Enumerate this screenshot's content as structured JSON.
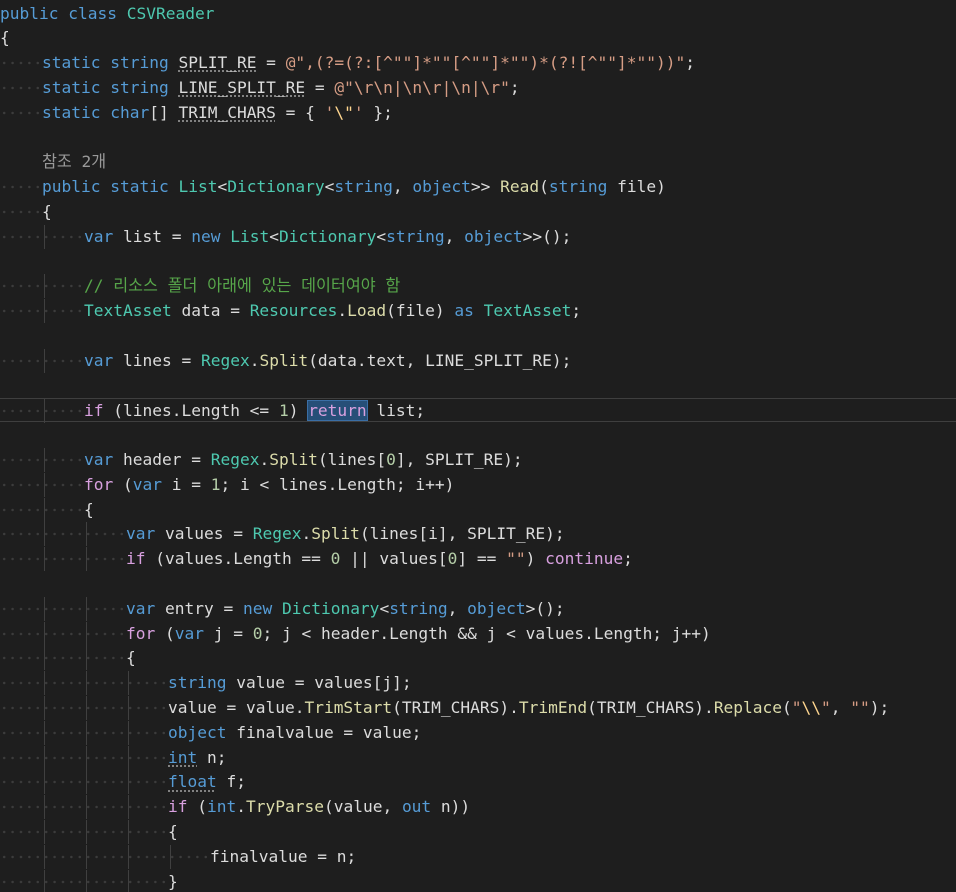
{
  "editor": {
    "language": "csharp",
    "theme": "dark",
    "lines": [
      {
        "indent": 0,
        "tokens": [
          {
            "c": "k",
            "v": "public"
          },
          {
            "c": "u",
            "v": " "
          },
          {
            "c": "k",
            "v": "class"
          },
          {
            "c": "u",
            "v": " "
          },
          {
            "c": "t",
            "v": "CSVReader"
          }
        ]
      },
      {
        "indent": 0,
        "tokens": [
          {
            "c": "u",
            "v": "{"
          }
        ]
      },
      {
        "indent": 1,
        "tokens": [
          {
            "c": "k",
            "v": "static"
          },
          {
            "c": "u",
            "v": " "
          },
          {
            "c": "k",
            "v": "string"
          },
          {
            "c": "u",
            "v": " "
          },
          {
            "c": "u sq",
            "v": "SPLIT_RE"
          },
          {
            "c": "u",
            "v": " = "
          },
          {
            "c": "s",
            "v": "@\",(?=(?:[^\"\"]*\"\"[^\"\"]*\"\")*(?![^\"\"]*\"\"))\""
          },
          {
            "c": "u",
            "v": ";"
          }
        ]
      },
      {
        "indent": 1,
        "tokens": [
          {
            "c": "k",
            "v": "static"
          },
          {
            "c": "u",
            "v": " "
          },
          {
            "c": "k",
            "v": "string"
          },
          {
            "c": "u",
            "v": " "
          },
          {
            "c": "u sq",
            "v": "LINE_SPLIT_RE"
          },
          {
            "c": "u",
            "v": " = "
          },
          {
            "c": "s",
            "v": "@\"\\r\\n|\\n\\r|\\n|\\r\""
          },
          {
            "c": "u",
            "v": ";"
          }
        ]
      },
      {
        "indent": 1,
        "tokens": [
          {
            "c": "k",
            "v": "static"
          },
          {
            "c": "u",
            "v": " "
          },
          {
            "c": "k",
            "v": "char"
          },
          {
            "c": "u",
            "v": "[] "
          },
          {
            "c": "u sq",
            "v": "TRIM_CHARS"
          },
          {
            "c": "u",
            "v": " = { "
          },
          {
            "c": "s",
            "v": "'"
          },
          {
            "c": "se",
            "v": "\\\""
          },
          {
            "c": "s",
            "v": "'"
          },
          {
            "c": "u",
            "v": " };"
          }
        ]
      },
      {
        "indent": 0,
        "blank": true,
        "tokens": []
      },
      {
        "indent": 1,
        "noguide": true,
        "tokens": [
          {
            "c": "ref",
            "v": "참조 2개"
          }
        ]
      },
      {
        "indent": 1,
        "tokens": [
          {
            "c": "k",
            "v": "public"
          },
          {
            "c": "u",
            "v": " "
          },
          {
            "c": "k",
            "v": "static"
          },
          {
            "c": "u",
            "v": " "
          },
          {
            "c": "t",
            "v": "List"
          },
          {
            "c": "u",
            "v": "<"
          },
          {
            "c": "t",
            "v": "Dictionary"
          },
          {
            "c": "u",
            "v": "<"
          },
          {
            "c": "k",
            "v": "string"
          },
          {
            "c": "u",
            "v": ", "
          },
          {
            "c": "k",
            "v": "object"
          },
          {
            "c": "u",
            "v": ">> "
          },
          {
            "c": "m",
            "v": "Read"
          },
          {
            "c": "u",
            "v": "("
          },
          {
            "c": "k",
            "v": "string"
          },
          {
            "c": "u",
            "v": " "
          },
          {
            "c": "u",
            "v": "file"
          },
          {
            "c": "u",
            "v": ")"
          }
        ]
      },
      {
        "indent": 1,
        "tokens": [
          {
            "c": "u",
            "v": "{"
          }
        ]
      },
      {
        "indent": 2,
        "tokens": [
          {
            "c": "k",
            "v": "var"
          },
          {
            "c": "u",
            "v": " list = "
          },
          {
            "c": "k",
            "v": "new"
          },
          {
            "c": "u",
            "v": " "
          },
          {
            "c": "t",
            "v": "List"
          },
          {
            "c": "u",
            "v": "<"
          },
          {
            "c": "t",
            "v": "Dictionary"
          },
          {
            "c": "u",
            "v": "<"
          },
          {
            "c": "k",
            "v": "string"
          },
          {
            "c": "u",
            "v": ", "
          },
          {
            "c": "k",
            "v": "object"
          },
          {
            "c": "u",
            "v": ">>();"
          }
        ]
      },
      {
        "indent": 0,
        "blank": true,
        "tokens": []
      },
      {
        "indent": 2,
        "tokens": [
          {
            "c": "c",
            "v": "// 리소스 폴더 아래에 있는 데이터여야 함"
          }
        ]
      },
      {
        "indent": 2,
        "tokens": [
          {
            "c": "t",
            "v": "TextAsset"
          },
          {
            "c": "u",
            "v": " data = "
          },
          {
            "c": "t",
            "v": "Resources"
          },
          {
            "c": "u",
            "v": "."
          },
          {
            "c": "m",
            "v": "Load"
          },
          {
            "c": "u",
            "v": "(file) "
          },
          {
            "c": "k",
            "v": "as"
          },
          {
            "c": "u",
            "v": " "
          },
          {
            "c": "t",
            "v": "TextAsset"
          },
          {
            "c": "u",
            "v": ";"
          }
        ]
      },
      {
        "indent": 0,
        "blank": true,
        "tokens": []
      },
      {
        "indent": 2,
        "tokens": [
          {
            "c": "k",
            "v": "var"
          },
          {
            "c": "u",
            "v": " lines = "
          },
          {
            "c": "t",
            "v": "Regex"
          },
          {
            "c": "u",
            "v": "."
          },
          {
            "c": "m",
            "v": "Split"
          },
          {
            "c": "u",
            "v": "(data.text, LINE_SPLIT_RE);"
          }
        ]
      },
      {
        "indent": 0,
        "blank": true,
        "tokens": []
      },
      {
        "indent": 2,
        "current": true,
        "tokens": [
          {
            "c": "ck",
            "v": "if"
          },
          {
            "c": "u",
            "v": " (lines.Length <= "
          },
          {
            "c": "n",
            "v": "1"
          },
          {
            "c": "u",
            "v": ") "
          },
          {
            "c": "ck sel",
            "v": "return"
          },
          {
            "c": "u",
            "v": " list;"
          }
        ]
      },
      {
        "indent": 0,
        "blank": true,
        "tokens": []
      },
      {
        "indent": 2,
        "tokens": [
          {
            "c": "k",
            "v": "var"
          },
          {
            "c": "u",
            "v": " header = "
          },
          {
            "c": "t",
            "v": "Regex"
          },
          {
            "c": "u",
            "v": "."
          },
          {
            "c": "m",
            "v": "Split"
          },
          {
            "c": "u",
            "v": "(lines["
          },
          {
            "c": "n",
            "v": "0"
          },
          {
            "c": "u",
            "v": "], SPLIT_RE);"
          }
        ]
      },
      {
        "indent": 2,
        "tokens": [
          {
            "c": "ck",
            "v": "for"
          },
          {
            "c": "u",
            "v": " ("
          },
          {
            "c": "k",
            "v": "var"
          },
          {
            "c": "u",
            "v": " i = "
          },
          {
            "c": "n",
            "v": "1"
          },
          {
            "c": "u",
            "v": "; i < lines.Length; i++)"
          }
        ]
      },
      {
        "indent": 2,
        "tokens": [
          {
            "c": "u",
            "v": "{"
          }
        ]
      },
      {
        "indent": 3,
        "tokens": [
          {
            "c": "k",
            "v": "var"
          },
          {
            "c": "u",
            "v": " values = "
          },
          {
            "c": "t",
            "v": "Regex"
          },
          {
            "c": "u",
            "v": "."
          },
          {
            "c": "m",
            "v": "Split"
          },
          {
            "c": "u",
            "v": "(lines[i], SPLIT_RE);"
          }
        ]
      },
      {
        "indent": 3,
        "tokens": [
          {
            "c": "ck",
            "v": "if"
          },
          {
            "c": "u",
            "v": " (values.Length == "
          },
          {
            "c": "n",
            "v": "0"
          },
          {
            "c": "u",
            "v": " || values["
          },
          {
            "c": "n",
            "v": "0"
          },
          {
            "c": "u",
            "v": "] == "
          },
          {
            "c": "s",
            "v": "\"\""
          },
          {
            "c": "u",
            "v": ") "
          },
          {
            "c": "ck",
            "v": "continue"
          },
          {
            "c": "u",
            "v": ";"
          }
        ]
      },
      {
        "indent": 0,
        "blank": true,
        "tokens": []
      },
      {
        "indent": 3,
        "tokens": [
          {
            "c": "k",
            "v": "var"
          },
          {
            "c": "u",
            "v": " entry = "
          },
          {
            "c": "k",
            "v": "new"
          },
          {
            "c": "u",
            "v": " "
          },
          {
            "c": "t",
            "v": "Dictionary"
          },
          {
            "c": "u",
            "v": "<"
          },
          {
            "c": "k",
            "v": "string"
          },
          {
            "c": "u",
            "v": ", "
          },
          {
            "c": "k",
            "v": "object"
          },
          {
            "c": "u",
            "v": ">();"
          }
        ]
      },
      {
        "indent": 3,
        "tokens": [
          {
            "c": "ck",
            "v": "for"
          },
          {
            "c": "u",
            "v": " ("
          },
          {
            "c": "k",
            "v": "var"
          },
          {
            "c": "u",
            "v": " j = "
          },
          {
            "c": "n",
            "v": "0"
          },
          {
            "c": "u",
            "v": "; j < header.Length && j < values.Length; j++)"
          }
        ]
      },
      {
        "indent": 3,
        "tokens": [
          {
            "c": "u",
            "v": "{"
          }
        ]
      },
      {
        "indent": 4,
        "tokens": [
          {
            "c": "k",
            "v": "string"
          },
          {
            "c": "u",
            "v": " value = values[j];"
          }
        ]
      },
      {
        "indent": 4,
        "tokens": [
          {
            "c": "u",
            "v": "value = value."
          },
          {
            "c": "m",
            "v": "TrimStart"
          },
          {
            "c": "u",
            "v": "(TRIM_CHARS)."
          },
          {
            "c": "m",
            "v": "TrimEnd"
          },
          {
            "c": "u",
            "v": "(TRIM_CHARS)."
          },
          {
            "c": "m",
            "v": "Replace"
          },
          {
            "c": "u",
            "v": "("
          },
          {
            "c": "s",
            "v": "\""
          },
          {
            "c": "se",
            "v": "\\\\"
          },
          {
            "c": "s",
            "v": "\""
          },
          {
            "c": "u",
            "v": ", "
          },
          {
            "c": "s",
            "v": "\"\""
          },
          {
            "c": "u",
            "v": ");"
          }
        ]
      },
      {
        "indent": 4,
        "tokens": [
          {
            "c": "k",
            "v": "object"
          },
          {
            "c": "u",
            "v": " finalvalue = value;"
          }
        ]
      },
      {
        "indent": 4,
        "tokens": [
          {
            "c": "k sq",
            "v": "int"
          },
          {
            "c": "u",
            "v": " n;"
          }
        ]
      },
      {
        "indent": 4,
        "tokens": [
          {
            "c": "k sq",
            "v": "float"
          },
          {
            "c": "u",
            "v": " f;"
          }
        ]
      },
      {
        "indent": 4,
        "tokens": [
          {
            "c": "ck",
            "v": "if"
          },
          {
            "c": "u",
            "v": " ("
          },
          {
            "c": "k",
            "v": "int"
          },
          {
            "c": "u",
            "v": "."
          },
          {
            "c": "m",
            "v": "TryParse"
          },
          {
            "c": "u",
            "v": "(value, "
          },
          {
            "c": "k",
            "v": "out"
          },
          {
            "c": "u",
            "v": " n))"
          }
        ]
      },
      {
        "indent": 4,
        "tokens": [
          {
            "c": "u",
            "v": "{"
          }
        ]
      },
      {
        "indent": 5,
        "tokens": [
          {
            "c": "u",
            "v": "finalvalue = n;"
          }
        ]
      },
      {
        "indent": 4,
        "tokens": [
          {
            "c": "u",
            "v": "}"
          }
        ]
      }
    ]
  }
}
